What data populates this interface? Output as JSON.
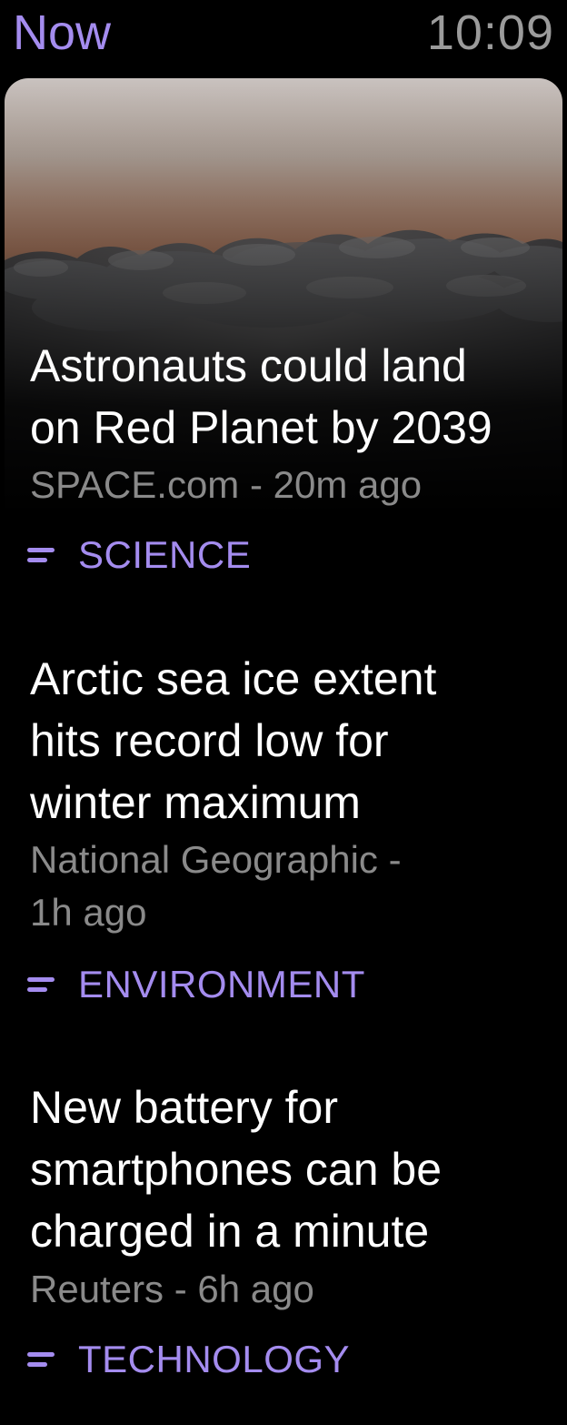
{
  "status_bar": {
    "title": "Now",
    "time": "10:09"
  },
  "colors": {
    "accent": "#a48cef",
    "background": "#000000",
    "secondary_text": "#8a8a8a"
  },
  "articles": [
    {
      "headline_lines": [
        "Astronauts could land",
        "on Red Planet by 2039"
      ],
      "source": "SPACE.com - 20m ago",
      "category": "SCIENCE",
      "category_icon": "lines-icon",
      "has_image": true
    },
    {
      "headline_lines": [
        "Arctic sea ice extent",
        "hits record low for",
        "winter maximum"
      ],
      "source_lines": [
        "National Geographic -",
        "1h ago"
      ],
      "category": "ENVIRONMENT",
      "category_icon": "lines-icon"
    },
    {
      "headline_lines": [
        "New battery for",
        "smartphones can be",
        "charged in a minute"
      ],
      "source": "Reuters - 6h ago",
      "category": "TECHNOLOGY",
      "category_icon": "lines-icon"
    }
  ]
}
